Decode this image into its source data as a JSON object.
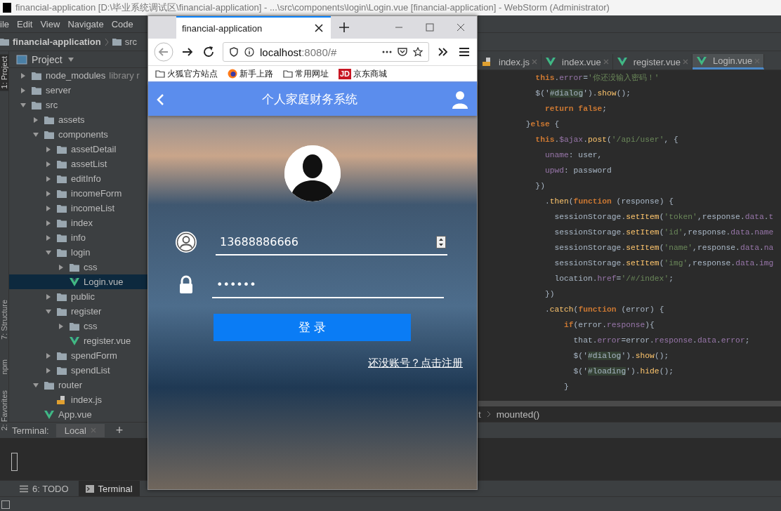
{
  "ide": {
    "title": "financial-application [D:\\毕业系统调试区\\financial-application] - ...\\src\\components\\login\\Login.vue [financial-application] - WebStorm (Administrator)",
    "menu": [
      "ile",
      "Edit",
      "View",
      "Navigate",
      "Code"
    ],
    "breadcrumb": [
      {
        "label": "financial-application",
        "kind": "project"
      },
      {
        "label": "src",
        "kind": "folder"
      }
    ],
    "tool_strip": [
      {
        "label": "1: Project",
        "selected": true
      },
      {
        "label": "7: Structure",
        "selected": false
      },
      {
        "label": "npm",
        "selected": false
      },
      {
        "label": "2: Favorites",
        "selected": false
      }
    ],
    "project_panel": {
      "title": "Project",
      "tree": [
        {
          "label": "node_modules",
          "note": "library r",
          "kind": "folder",
          "expanded": false,
          "selected": false
        },
        {
          "label": "server",
          "kind": "folder",
          "expanded": false,
          "selected": false
        },
        {
          "label": "src",
          "kind": "folder",
          "expanded": true,
          "selected": false,
          "children": [
            {
              "label": "assets",
              "kind": "folder",
              "expanded": false,
              "selected": false
            },
            {
              "label": "components",
              "kind": "folder",
              "expanded": true,
              "selected": false,
              "children": [
                {
                  "label": "assetDetail",
                  "kind": "folder",
                  "expanded": false,
                  "selected": false
                },
                {
                  "label": "assetList",
                  "kind": "folder",
                  "expanded": false,
                  "selected": false
                },
                {
                  "label": "editInfo",
                  "kind": "folder",
                  "expanded": false,
                  "selected": false
                },
                {
                  "label": "incomeForm",
                  "kind": "folder",
                  "expanded": false,
                  "selected": false
                },
                {
                  "label": "incomeList",
                  "kind": "folder",
                  "expanded": false,
                  "selected": false
                },
                {
                  "label": "index",
                  "kind": "folder",
                  "expanded": false,
                  "selected": false
                },
                {
                  "label": "info",
                  "kind": "folder",
                  "expanded": false,
                  "selected": false
                },
                {
                  "label": "login",
                  "kind": "folder",
                  "expanded": true,
                  "selected": false,
                  "children": [
                    {
                      "label": "css",
                      "kind": "folder",
                      "expanded": false,
                      "selected": false
                    },
                    {
                      "label": "Login.vue",
                      "kind": "vue",
                      "selected": true
                    }
                  ]
                },
                {
                  "label": "public",
                  "kind": "folder",
                  "expanded": false,
                  "selected": false
                },
                {
                  "label": "register",
                  "kind": "folder",
                  "expanded": true,
                  "selected": false,
                  "children": [
                    {
                      "label": "css",
                      "kind": "folder",
                      "expanded": false,
                      "selected": false
                    },
                    {
                      "label": "register.vue",
                      "kind": "vue",
                      "selected": false
                    }
                  ]
                },
                {
                  "label": "spendForm",
                  "kind": "folder",
                  "expanded": false,
                  "selected": false
                },
                {
                  "label": "spendList",
                  "kind": "folder",
                  "expanded": false,
                  "selected": false
                }
              ]
            },
            {
              "label": "router",
              "kind": "folder",
              "expanded": true,
              "selected": false,
              "children": [
                {
                  "label": "index.js",
                  "kind": "js",
                  "selected": false
                }
              ]
            },
            {
              "label": "App.vue",
              "kind": "vue",
              "selected": false
            }
          ]
        }
      ]
    },
    "editor_tabs": [
      {
        "label": "index.js",
        "kind": "js",
        "selected": false
      },
      {
        "label": "index.vue",
        "kind": "vue",
        "selected": false
      },
      {
        "label": "register.vue",
        "kind": "vue",
        "selected": false
      },
      {
        "label": "Login.vue",
        "kind": "vue",
        "selected": true
      }
    ],
    "code_lines": [
      [
        {
          "kind": "kw",
          "text": "            this"
        },
        {
          "kind": "plain",
          "text": "."
        },
        {
          "kind": "prop",
          "text": "error"
        },
        {
          "kind": "plain",
          "text": "="
        },
        {
          "kind": "str",
          "text": "'你还没输入密码！'"
        }
      ],
      [
        {
          "kind": "plain",
          "text": "            $('"
        },
        {
          "kind": "hl",
          "text": "#dialog"
        },
        {
          "kind": "plain",
          "text": "')."
        },
        {
          "kind": "fn",
          "text": "show"
        },
        {
          "kind": "plain",
          "text": "();"
        }
      ],
      [
        {
          "kind": "kw",
          "text": "              return false"
        },
        {
          "kind": "plain",
          "text": ";"
        }
      ],
      [
        {
          "kind": "plain",
          "text": "          }"
        },
        {
          "kind": "kw",
          "text": "else"
        },
        {
          "kind": "plain",
          "text": " {"
        }
      ],
      [
        {
          "kind": "kw",
          "text": "            this"
        },
        {
          "kind": "plain",
          "text": "."
        },
        {
          "kind": "prop",
          "text": "$ajax"
        },
        {
          "kind": "plain",
          "text": "."
        },
        {
          "kind": "fn",
          "text": "post"
        },
        {
          "kind": "plain",
          "text": "("
        },
        {
          "kind": "str",
          "text": "'/api/user'"
        },
        {
          "kind": "plain",
          "text": ", {"
        }
      ],
      [
        {
          "kind": "prop",
          "text": "              uname"
        },
        {
          "kind": "plain",
          "text": ": user,"
        }
      ],
      [
        {
          "kind": "prop",
          "text": "              upwd"
        },
        {
          "kind": "plain",
          "text": ": password"
        }
      ],
      [
        {
          "kind": "plain",
          "text": "            })"
        }
      ],
      [
        {
          "kind": "plain",
          "text": "              ."
        },
        {
          "kind": "fn",
          "text": "then"
        },
        {
          "kind": "plain",
          "text": "("
        },
        {
          "kind": "kw",
          "text": "function"
        },
        {
          "kind": "plain",
          "text": " (response) {"
        }
      ],
      [
        {
          "kind": "plain",
          "text": "                sessionStorage."
        },
        {
          "kind": "fn",
          "text": "setItem"
        },
        {
          "kind": "plain",
          "text": "("
        },
        {
          "kind": "str",
          "text": "'token'"
        },
        {
          "kind": "plain",
          "text": ",response."
        },
        {
          "kind": "prop",
          "text": "data"
        },
        {
          "kind": "plain",
          "text": "."
        },
        {
          "kind": "prop",
          "text": "t"
        }
      ],
      [
        {
          "kind": "plain",
          "text": "                sessionStorage."
        },
        {
          "kind": "fn",
          "text": "setItem"
        },
        {
          "kind": "plain",
          "text": "("
        },
        {
          "kind": "str",
          "text": "'id'"
        },
        {
          "kind": "plain",
          "text": ",response."
        },
        {
          "kind": "prop",
          "text": "data"
        },
        {
          "kind": "plain",
          "text": "."
        },
        {
          "kind": "prop",
          "text": "name"
        }
      ],
      [
        {
          "kind": "plain",
          "text": "                sessionStorage."
        },
        {
          "kind": "fn",
          "text": "setItem"
        },
        {
          "kind": "plain",
          "text": "("
        },
        {
          "kind": "str",
          "text": "'name'"
        },
        {
          "kind": "plain",
          "text": ",response."
        },
        {
          "kind": "prop",
          "text": "data"
        },
        {
          "kind": "plain",
          "text": "."
        },
        {
          "kind": "prop",
          "text": "na"
        }
      ],
      [
        {
          "kind": "plain",
          "text": "                sessionStorage."
        },
        {
          "kind": "fn",
          "text": "setItem"
        },
        {
          "kind": "plain",
          "text": "("
        },
        {
          "kind": "str",
          "text": "'img'"
        },
        {
          "kind": "plain",
          "text": ",response."
        },
        {
          "kind": "prop",
          "text": "data"
        },
        {
          "kind": "plain",
          "text": "."
        },
        {
          "kind": "prop",
          "text": "img"
        }
      ],
      [
        {
          "kind": "plain",
          "text": "                location."
        },
        {
          "kind": "prop",
          "text": "href"
        },
        {
          "kind": "plain",
          "text": "="
        },
        {
          "kind": "str",
          "text": "'/#/index'"
        },
        {
          "kind": "plain",
          "text": ";"
        }
      ],
      [
        {
          "kind": "plain",
          "text": "              })"
        }
      ],
      [
        {
          "kind": "plain",
          "text": "              ."
        },
        {
          "kind": "fn",
          "text": "catch"
        },
        {
          "kind": "plain",
          "text": "("
        },
        {
          "kind": "kw",
          "text": "function"
        },
        {
          "kind": "plain",
          "text": " (error) {"
        }
      ],
      [
        {
          "kind": "kw",
          "text": "                  if"
        },
        {
          "kind": "plain",
          "text": "(error."
        },
        {
          "kind": "prop",
          "text": "response"
        },
        {
          "kind": "plain",
          "text": "){"
        }
      ],
      [
        {
          "kind": "plain",
          "text": "                    that."
        },
        {
          "kind": "prop",
          "text": "error"
        },
        {
          "kind": "plain",
          "text": "=error."
        },
        {
          "kind": "prop",
          "text": "response"
        },
        {
          "kind": "plain",
          "text": "."
        },
        {
          "kind": "prop",
          "text": "data"
        },
        {
          "kind": "plain",
          "text": "."
        },
        {
          "kind": "prop",
          "text": "error"
        },
        {
          "kind": "plain",
          "text": ";"
        }
      ],
      [
        {
          "kind": "plain",
          "text": "                    $('"
        },
        {
          "kind": "hl",
          "text": "#dialog"
        },
        {
          "kind": "plain",
          "text": "')."
        },
        {
          "kind": "fn",
          "text": "show"
        },
        {
          "kind": "plain",
          "text": "();"
        }
      ],
      [
        {
          "kind": "plain",
          "text": "                    $('"
        },
        {
          "kind": "hl",
          "text": "#loading"
        },
        {
          "kind": "plain",
          "text": "')."
        },
        {
          "kind": "fn",
          "text": "hide"
        },
        {
          "kind": "plain",
          "text": "();"
        }
      ],
      [
        {
          "kind": "plain",
          "text": "                  }"
        }
      ]
    ],
    "code_breadcrumb": [
      "t",
      "mounted()"
    ],
    "terminal": {
      "label": "Terminal:",
      "tabs": [
        {
          "label": "Local",
          "selected": true
        }
      ],
      "add": "+"
    },
    "bottom_tools": [
      {
        "label": "6: TODO",
        "kind": "todo",
        "selected": false
      },
      {
        "label": "Terminal",
        "kind": "terminal",
        "selected": true
      }
    ]
  },
  "browser": {
    "tab_title": "financial-application",
    "url_host": "localhost",
    "url_rest": ":8080/#",
    "bookmarks": [
      {
        "label": "火狐官方站点",
        "kind": "folder"
      },
      {
        "label": "新手上路",
        "kind": "firefox"
      },
      {
        "label": "常用网址",
        "kind": "folder"
      },
      {
        "label": "京东商城",
        "kind": "jd",
        "icon_text": "JD"
      }
    ],
    "page": {
      "title": "个人家庭财务系统",
      "phone": "13688886666",
      "password": "••••••",
      "login_button": "登 录",
      "register_link": "还没账号？点击注册"
    }
  }
}
